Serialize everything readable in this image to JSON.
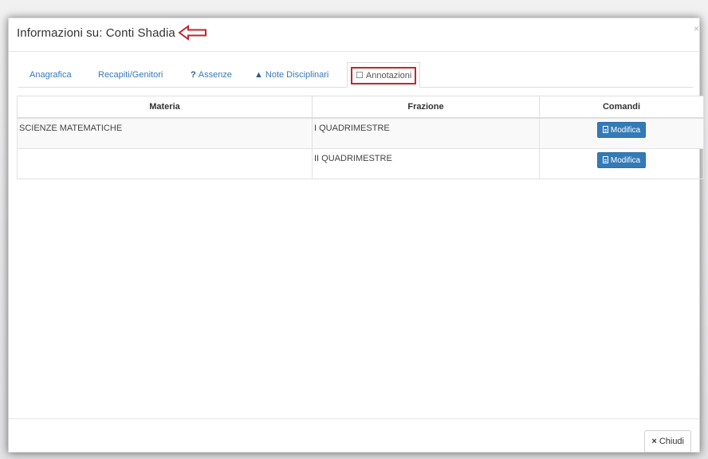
{
  "modal": {
    "title": "Informazioni su: Conti Shadia",
    "close_symbol": "×"
  },
  "tabs": [
    {
      "label": "Anagrafica",
      "icon": ""
    },
    {
      "label": "Recapiti/Genitori",
      "icon": ""
    },
    {
      "label": "Assenze",
      "icon": "question-icon",
      "glyph": "?"
    },
    {
      "label": "Note Disciplinari",
      "icon": "warning-icon",
      "glyph": "▲"
    },
    {
      "label": "Annotazioni",
      "icon": "comment-icon",
      "glyph": "☐",
      "active": true
    }
  ],
  "table": {
    "headers": [
      "Materia",
      "Frazione",
      "Comandi"
    ],
    "rows": [
      {
        "materia": "SCIENZE MATEMATICHE",
        "frazione": "I QUADRIMESTRE",
        "button": "Modifica"
      },
      {
        "materia": "",
        "frazione": "II QUADRIMESTRE",
        "button": "Modifica"
      }
    ]
  },
  "footer": {
    "close_label": "Chiudi",
    "close_glyph": "×"
  },
  "colors": {
    "link": "#337ab7",
    "primary_button": "#337ab7",
    "highlight": "#c1272d"
  }
}
